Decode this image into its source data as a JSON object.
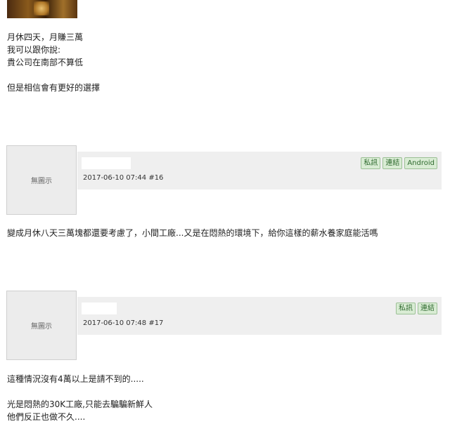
{
  "post1": {
    "lines": [
      "月休四天，月賺三萬",
      "我可以跟你說:",
      "貴公司在南部不算低",
      "",
      "但是相信會有更好的選擇"
    ]
  },
  "post16": {
    "avatar_text": "無圖示",
    "date": "2017-06-10 07:44",
    "floor": "#16",
    "buttons": [
      "私訊",
      "連結",
      "Android"
    ],
    "content": "變成月休八天三萬塊都還要考慮了，小間工廠...又是在悶熱的環境下，給你這樣的薪水養家庭能活嗎"
  },
  "post17": {
    "avatar_text": "無圖示",
    "date": "2017-06-10 07:48",
    "floor": "#17",
    "buttons": [
      "私訊",
      "連結"
    ],
    "lines": [
      "這種情況沒有4萬以上是請不到的.....",
      "",
      "光是悶熱的30K工廠,只能去騙騙新鮮人",
      "他們反正也做不久...."
    ]
  }
}
